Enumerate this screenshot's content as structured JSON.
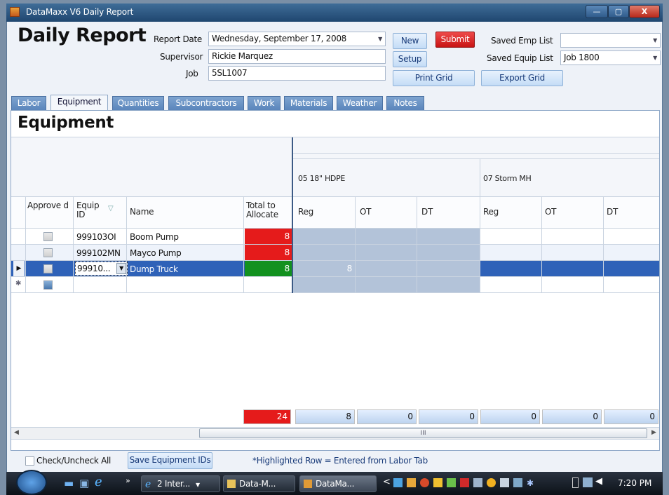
{
  "window": {
    "title": "DataMaxx V6 Daily Report",
    "minimize": "—",
    "maximize": "▢",
    "close": "X"
  },
  "header": {
    "title": "Daily Report",
    "report_date_label": "Report Date",
    "report_date_value": "Wednesday, September 17, 2008",
    "supervisor_label": "Supervisor",
    "supervisor_value": "Rickie Marquez",
    "job_label": "Job",
    "job_value": "5SL1007",
    "new_label": "New",
    "submit_label": "Submit",
    "setup_label": "Setup",
    "print_grid_label": "Print Grid",
    "export_grid_label": "Export Grid",
    "saved_emp_label": "Saved Emp List",
    "saved_emp_value": "",
    "saved_equip_label": "Saved Equip List",
    "saved_equip_value": "Job 1800"
  },
  "tabs": [
    "Labor",
    "Equipment",
    "Quantities",
    "Subcontractors",
    "Work",
    "Materials",
    "Weather",
    "Notes"
  ],
  "active_tab": "Equipment",
  "section_title": "Equipment",
  "grid": {
    "groups": [
      "05 18\" HDPE",
      "07 Storm MH"
    ],
    "columns": {
      "approve": "Approve d",
      "equip_id": "Equip ID",
      "name": "Name",
      "total": "Total to Allocate",
      "reg": "Reg",
      "ot": "OT",
      "dt": "DT"
    },
    "rows": [
      {
        "id": "999103OI",
        "name": "Boom Pump",
        "total": "8",
        "reg1": ""
      },
      {
        "id": "999102MN",
        "name": "Mayco Pump",
        "total": "8",
        "reg1": ""
      },
      {
        "id": "99910...",
        "name": "Dump Truck",
        "total": "8",
        "reg1": "8"
      }
    ],
    "totals": {
      "total": "24",
      "reg1": "8",
      "ot1": "0",
      "dt1": "0",
      "reg2": "0",
      "ot2": "0",
      "dt2": "0"
    },
    "scroll_marker": "III"
  },
  "footer": {
    "check_all_label": "Check/Uncheck All",
    "save_ids_label": "Save Equipment IDs",
    "note": "*Highlighted Row = Entered from Labor Tab"
  },
  "taskbar": {
    "items": [
      "2 Inter...",
      "Data-M...",
      "DataMa..."
    ],
    "clock": "7:20 PM"
  },
  "colors": {
    "red": "#e51b1b",
    "green": "#12911f",
    "selected": "#2f62b8",
    "shaded": "#b3c3d9"
  }
}
